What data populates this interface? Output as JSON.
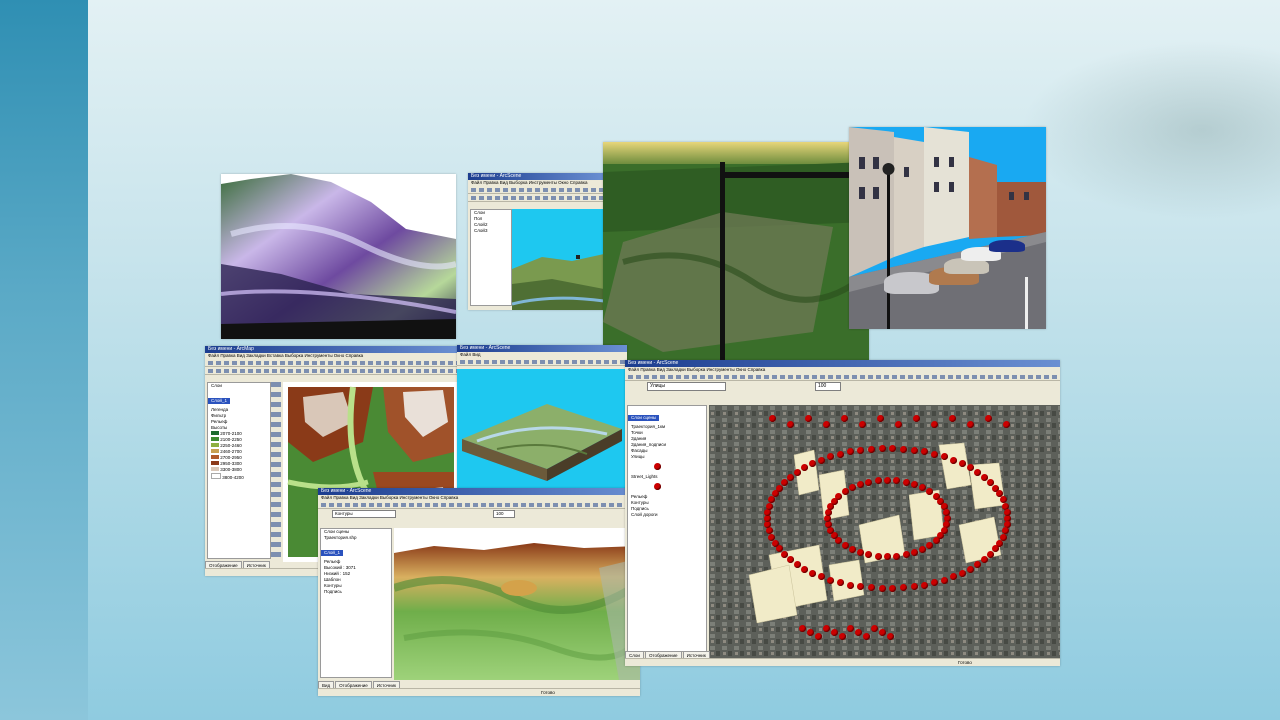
{
  "windows": {
    "arcscene_top": {
      "title": "Без имени - ArcScene",
      "menu": "Файл  Правка  Вид  Выборка  Инструменты  Окно  Справка",
      "toc_items": [
        "Слои",
        "Пол",
        "Слой2",
        "Слой3"
      ]
    },
    "arcmap_left": {
      "title": "Без имени - ArcMap",
      "menu": "Файл  Правка  Вид  Закладки  Вставка  Выборка  Инструменты  Окно  Справка",
      "toc_items": [
        "Слои",
        "Слой_1",
        "Легенда",
        "Фильтр",
        "Рельеф",
        "Высоты",
        "2070-2100",
        "2100-2250",
        "2250-2460",
        "2460-2700",
        "2700-2950",
        "2950-3300",
        "3300-3800",
        "3800-4200"
      ],
      "tabs": [
        "Отображение",
        "Источник"
      ]
    },
    "arcscene_mid": {
      "title": "Без имени - ArcScene",
      "menu": "Файл  Вид"
    },
    "arcscene_bottom": {
      "title": "Без имени - ArcScene",
      "menu": "Файл  Правка  Вид  Закладки  Выборка  Инструменты  Окно  Справка",
      "toc_items": [
        "Слои сцены",
        "Траектория.shp",
        "Слой_1",
        "Рельеф",
        "Высокий : 3071",
        "Низкий : 152",
        "Шаблон",
        "Контуры",
        "Подпись"
      ],
      "tabs": [
        "Вид",
        "Отображение",
        "Источник"
      ],
      "layer_value": "Контуры",
      "zoom": "100",
      "status": "Готово"
    },
    "arcscene_city": {
      "title": "Без имени - ArcScene",
      "menu": "Файл  Правка  Вид  Закладки  Выборка  Инструменты  Окно  Справка",
      "toc_items": [
        "Слои сцены",
        "Траектория_1км",
        "Точки",
        "Здания",
        "Здания_подписи",
        "Фасады",
        "Улицы",
        "Street_Lights",
        "Рельеф",
        "Контуры",
        "Подпись",
        "Слой дороги"
      ],
      "tabs": [
        "Слои",
        "Отображение",
        "Источник"
      ],
      "layer_value": "Улицы",
      "zoom": "100",
      "status": "Готово"
    }
  },
  "colors": {
    "titlebar": "#1c3d8f",
    "pin": "#cc0000",
    "sky": "#1ec8f0"
  }
}
